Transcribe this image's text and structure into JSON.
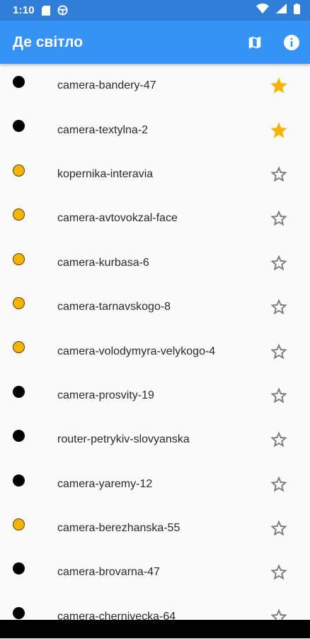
{
  "status_bar": {
    "time": "1:10"
  },
  "app_bar": {
    "title": "Де світло"
  },
  "colors": {
    "online_dot": "#f4b400",
    "offline_dot": "#000000",
    "favorite_star": "#f6b400",
    "app_bar": "#3593f4"
  },
  "items": [
    {
      "label": "camera-bandery-47",
      "status": "black",
      "favorite": true
    },
    {
      "label": "camera-textylna-2",
      "status": "black",
      "favorite": true
    },
    {
      "label": "kopernika-interavia",
      "status": "yellow",
      "favorite": false
    },
    {
      "label": "camera-avtovokzal-face",
      "status": "yellow",
      "favorite": false
    },
    {
      "label": "camera-kurbasa-6",
      "status": "yellow",
      "favorite": false
    },
    {
      "label": "camera-tarnavskogo-8",
      "status": "yellow",
      "favorite": false
    },
    {
      "label": "camera-volodymyra-velykogo-4",
      "status": "yellow",
      "favorite": false
    },
    {
      "label": "camera-prosvity-19",
      "status": "black",
      "favorite": false
    },
    {
      "label": "router-petrykiv-slovyanska",
      "status": "black",
      "favorite": false
    },
    {
      "label": "camera-yaremy-12",
      "status": "black",
      "favorite": false
    },
    {
      "label": "camera-berezhanska-55",
      "status": "yellow",
      "favorite": false
    },
    {
      "label": "camera-brovarna-47",
      "status": "black",
      "favorite": false
    },
    {
      "label": "camera-chernivecka-64",
      "status": "black",
      "favorite": false
    }
  ]
}
